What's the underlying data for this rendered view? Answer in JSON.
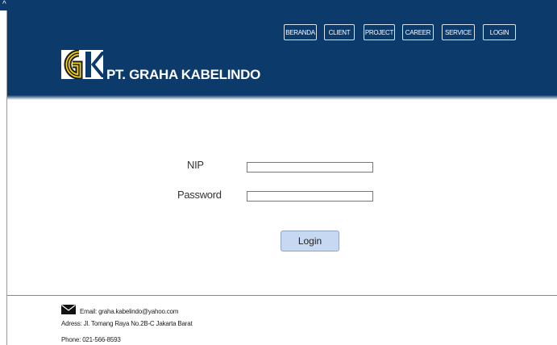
{
  "window": {
    "corner_label": "^"
  },
  "nav": {
    "items": [
      {
        "label": "BERANDA"
      },
      {
        "label": "CLIENT"
      },
      {
        "label": "PROJECT"
      },
      {
        "label": "CAREER"
      },
      {
        "label": "SERVICE"
      },
      {
        "label": "LOGIN"
      }
    ]
  },
  "brand": {
    "name": "PT. GRAHA KABELINDO",
    "primary_color": "#0b3a6b",
    "logo_colors": [
      "#f2d20b",
      "#1a1a1a",
      "#ffffff"
    ]
  },
  "form": {
    "nip_label": "NIP",
    "nip_value": "",
    "password_label": "Password",
    "password_value": "",
    "submit_label": "Login"
  },
  "footer": {
    "email_label": "Email:",
    "email": "graha.kabelindo@yahoo.com",
    "address_label": "Adress:",
    "address": "Jl. Tomang Raya No.2B-C Jakarta Barat",
    "phone_label": "Phone:",
    "phone": "021-566-8593"
  }
}
